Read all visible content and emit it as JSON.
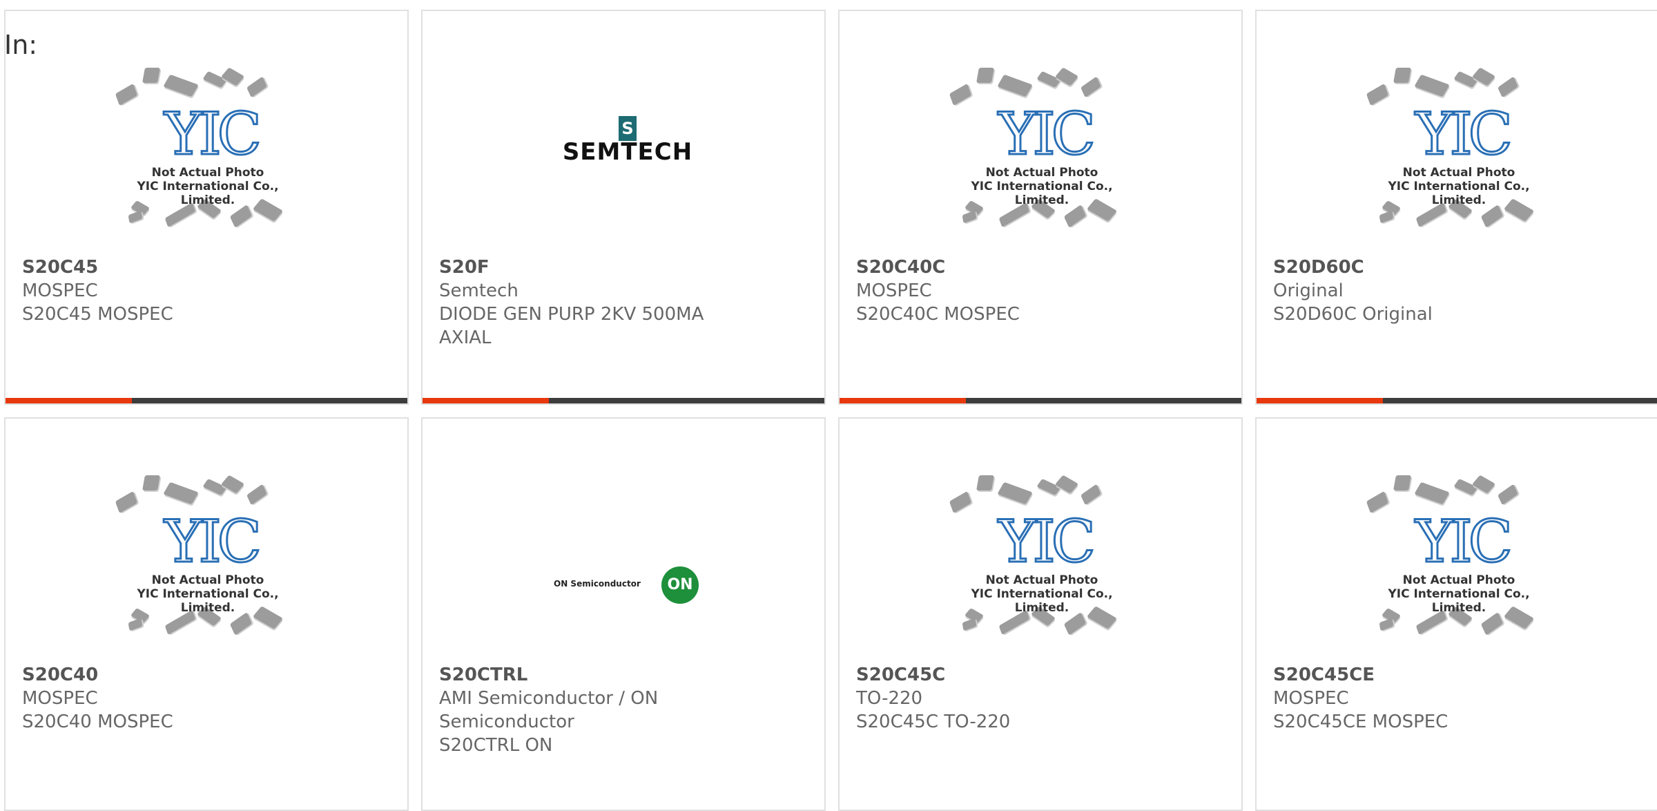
{
  "header": {
    "in_label": "In:"
  },
  "placeholder": {
    "caption_line1": "Not Actual Photo",
    "caption_line2": "YIC International Co., Limited.",
    "logo_text": "YIC"
  },
  "brand_logos": {
    "semtech": "SEMTECH",
    "onsemi_text": "ON Semiconductor",
    "onsemi_circle": "ON"
  },
  "products": [
    {
      "part": "S20C45",
      "maker": "MOSPEC",
      "desc": "S20C45 MOSPEC",
      "thumb": "placeholder"
    },
    {
      "part": "S20F",
      "maker": "Semtech",
      "desc": "DIODE GEN PURP 2KV 500MA AXIAL",
      "thumb": "semtech-logo"
    },
    {
      "part": "S20C40C",
      "maker": "MOSPEC",
      "desc": "S20C40C MOSPEC",
      "thumb": "placeholder"
    },
    {
      "part": "S20D60C",
      "maker": "Original",
      "desc": "S20D60C Original",
      "thumb": "placeholder"
    },
    {
      "part": "S20C40",
      "maker": "MOSPEC",
      "desc": "S20C40 MOSPEC",
      "thumb": "placeholder"
    },
    {
      "part": "S20CTRL",
      "maker": "AMI Semiconductor / ON Semiconductor",
      "desc": "S20CTRL ON",
      "thumb": "onsemi-logo"
    },
    {
      "part": "S20C45C",
      "maker": "TO-220",
      "desc": "S20C45C TO-220",
      "thumb": "placeholder"
    },
    {
      "part": "S20C45CE",
      "maker": "MOSPEC",
      "desc": "S20C45CE MOSPEC",
      "thumb": "placeholder"
    }
  ],
  "colors": {
    "accent": "#e8380d",
    "bar_dark": "#3d3d3d",
    "yic_blue": "#2a6fb5"
  }
}
